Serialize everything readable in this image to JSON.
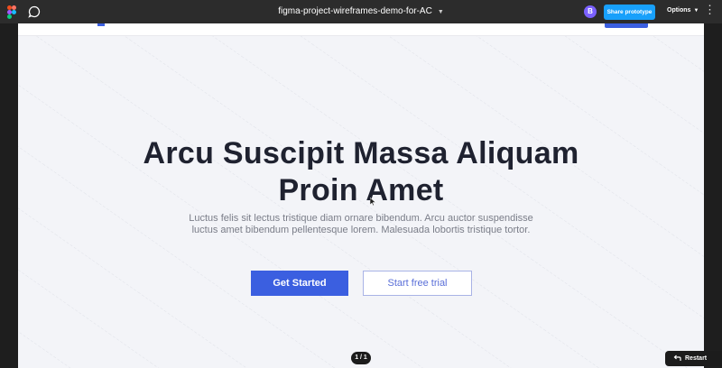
{
  "app": {
    "file_title": "figma-project-wireframes-demo-for-AC",
    "avatar_initial": "B",
    "share_label": "Share prototype",
    "options_label": "Options",
    "accent": "#18a0fb"
  },
  "hero": {
    "headline_line1": "Arcu Suscipit Massa Aliquam",
    "headline_line2": "Proin Amet",
    "subtext": "Luctus felis sit lectus tristique diam ornare bibendum. Arcu auctor suspendisse luctus amet bibendum pellentesque lorem. Malesuada lobortis tristique tortor.",
    "primary_label": "Get Started",
    "secondary_label": "Start free trial",
    "brand_color": "#3b5fe0"
  },
  "controls": {
    "page_indicator": "1 / 1",
    "restart_label": "Restart"
  }
}
